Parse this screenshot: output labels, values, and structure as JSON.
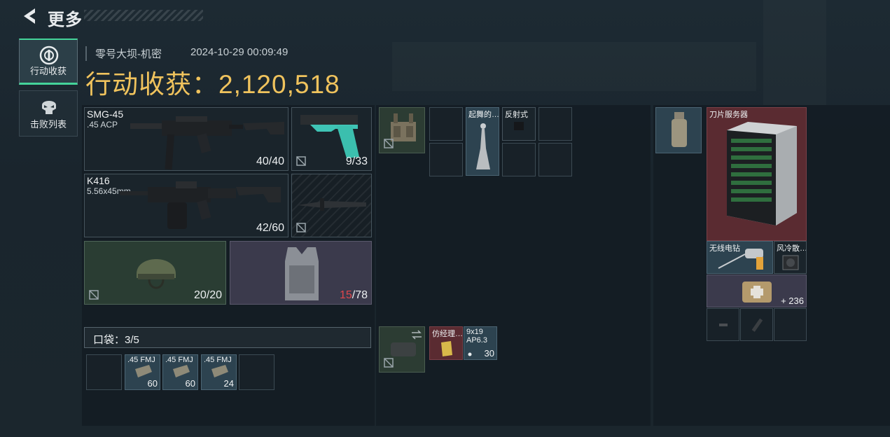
{
  "header": {
    "back_icon": "back-arrow-icon",
    "title": "更多"
  },
  "nav": [
    {
      "label": "行动收获",
      "icon": "loot-icon",
      "active": true
    },
    {
      "label": "击败列表",
      "icon": "skull-icon",
      "active": false
    }
  ],
  "raid": {
    "map": "零号大坝-机密",
    "datetime": "2024-10-29 00:09:49",
    "loot_label": "行动收获：",
    "loot_value": "2,120,518"
  },
  "equipment": {
    "primary_weapon": {
      "name": "SMG-45",
      "caliber": ".45 ACP",
      "ammo": "40/40"
    },
    "pistol": {
      "ammo": "9/33"
    },
    "secondary_weapon": {
      "name": "K416",
      "caliber": "5.56x45mm",
      "ammo": "42/60"
    },
    "melee": {},
    "helmet": {
      "durability": "20/20"
    },
    "armor": {
      "durability_current": "15",
      "durability_max": "/78"
    }
  },
  "pockets": {
    "label": "口袋：3/5",
    "items": [
      {
        "empty": true
      },
      {
        "name": ".45 FMJ",
        "count": "60"
      },
      {
        "name": ".45 FMJ",
        "count": "60"
      },
      {
        "name": ".45 FMJ",
        "count": "24"
      },
      {
        "empty": true
      }
    ]
  },
  "chest_rig": {
    "items": [
      {
        "name": "起舞的…"
      },
      {
        "name": "反射式"
      }
    ]
  },
  "bag_items": [
    {
      "name": "仿经理…"
    },
    {
      "name": "9x19 AP6.3",
      "count": "30"
    }
  ],
  "backpack": {
    "items": [
      {
        "name": "刀片服务器"
      },
      {
        "name": "无线电钻"
      },
      {
        "name": "风冷散…"
      },
      {
        "name": "",
        "count": "+ 236"
      }
    ]
  },
  "colors": {
    "accent_green": "#44d49a",
    "loot_gold": "#f0c35d",
    "red": "#e0474c"
  }
}
